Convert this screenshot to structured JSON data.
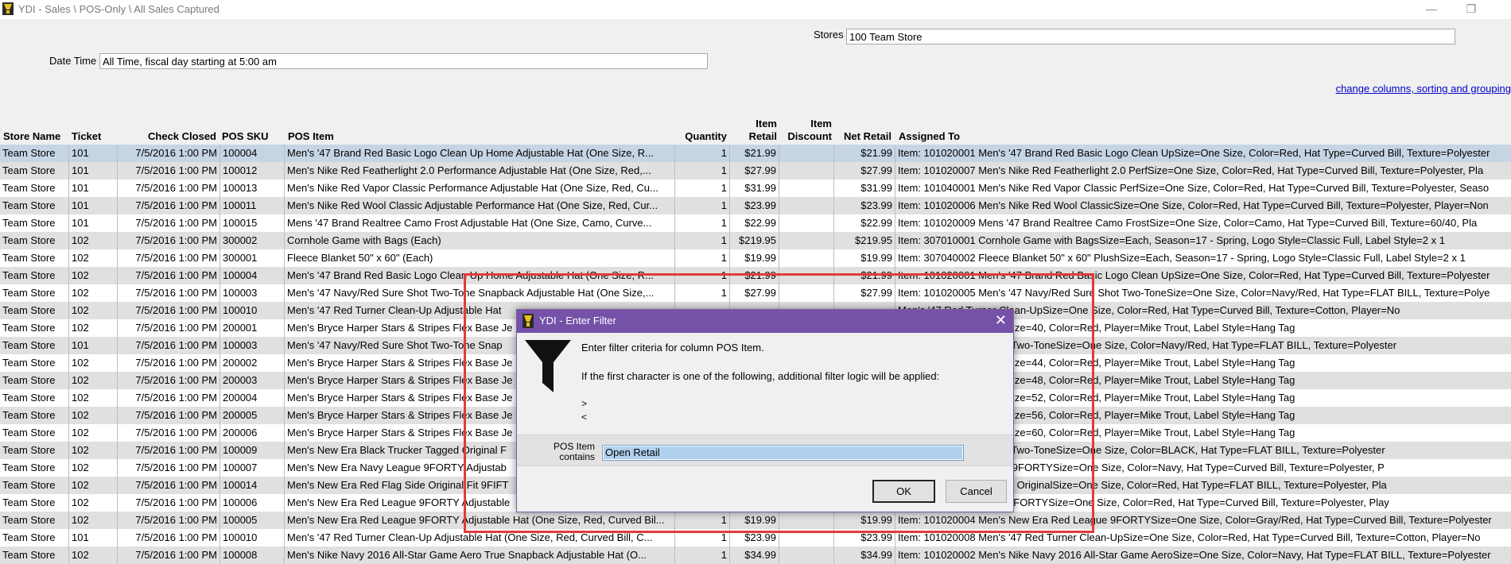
{
  "window": {
    "title": "YDI - Sales \\ POS-Only \\ All Sales Captured",
    "minimize": "—",
    "maximize": "❐"
  },
  "filters": {
    "stores_label": "Stores",
    "stores_value": "100 Team Store",
    "datetime_label": "Date Time",
    "datetime_value": "All Time, fiscal day starting at 5:00 am",
    "change_link": "change columns, sorting and grouping"
  },
  "columns": {
    "store_name": "Store Name",
    "ticket": "Ticket",
    "check_closed": "Check Closed",
    "pos_sku": "POS SKU",
    "pos_item": "POS Item",
    "quantity": "Quantity",
    "item_retail_1": "Item",
    "item_retail_2": "Retail",
    "item_discount_1": "Item",
    "item_discount_2": "Discount",
    "net_retail": "Net Retail",
    "assigned_to": "Assigned To"
  },
  "rows": [
    {
      "store": "Team Store",
      "ticket": "101",
      "closed": "7/5/2016 1:00 PM",
      "sku": "100004",
      "item": "Men's '47 Brand Red Basic Logo Clean Up Home Adjustable Hat (One Size, R...",
      "qty": "1",
      "retail": "$21.99",
      "discount": "",
      "net": "$21.99",
      "assigned": "Item: 101020001 Men's '47 Brand Red Basic Logo Clean UpSize=One Size, Color=Red, Hat Type=Curved Bill, Texture=Polyester"
    },
    {
      "store": "Team Store",
      "ticket": "101",
      "closed": "7/5/2016 1:00 PM",
      "sku": "100012",
      "item": "Men's Nike Red Featherlight 2.0 Performance Adjustable Hat (One Size, Red,...",
      "qty": "1",
      "retail": "$27.99",
      "discount": "",
      "net": "$27.99",
      "assigned": "Item: 101020007 Men's Nike Red Featherlight 2.0 PerfSize=One Size, Color=Red, Hat Type=Curved Bill, Texture=Polyester, Pla"
    },
    {
      "store": "Team Store",
      "ticket": "101",
      "closed": "7/5/2016 1:00 PM",
      "sku": "100013",
      "item": "Men's Nike Red Vapor Classic Performance Adjustable Hat (One Size, Red, Cu...",
      "qty": "1",
      "retail": "$31.99",
      "discount": "",
      "net": "$31.99",
      "assigned": "Item: 101040001 Men's Nike Red Vapor Classic PerfSize=One Size, Color=Red, Hat Type=Curved Bill, Texture=Polyester, Seaso"
    },
    {
      "store": "Team Store",
      "ticket": "101",
      "closed": "7/5/2016 1:00 PM",
      "sku": "100011",
      "item": "Men's Nike Red Wool Classic Adjustable Performance Hat (One Size, Red, Cur...",
      "qty": "1",
      "retail": "$23.99",
      "discount": "",
      "net": "$23.99",
      "assigned": "Item: 101020006 Men's Nike Red Wool ClassicSize=One Size, Color=Red, Hat Type=Curved Bill, Texture=Polyester, Player=Non"
    },
    {
      "store": "Team Store",
      "ticket": "101",
      "closed": "7/5/2016 1:00 PM",
      "sku": "100015",
      "item": "Mens '47 Brand Realtree Camo Frost Adjustable Hat (One Size, Camo, Curve...",
      "qty": "1",
      "retail": "$22.99",
      "discount": "",
      "net": "$22.99",
      "assigned": "Item: 101020009 Mens '47 Brand Realtree Camo FrostSize=One Size, Color=Camo, Hat Type=Curved Bill, Texture=60/40, Pla"
    },
    {
      "store": "Team Store",
      "ticket": "102",
      "closed": "7/5/2016 1:00 PM",
      "sku": "300002",
      "item": "Cornhole Game with Bags (Each)",
      "qty": "1",
      "retail": "$219.95",
      "discount": "",
      "net": "$219.95",
      "assigned": "Item: 307010001 Cornhole Game with BagsSize=Each, Season=17 - Spring, Logo Style=Classic Full, Label Style=2 x 1"
    },
    {
      "store": "Team Store",
      "ticket": "102",
      "closed": "7/5/2016 1:00 PM",
      "sku": "300001",
      "item": "Fleece Blanket 50\" x 60\" (Each)",
      "qty": "1",
      "retail": "$19.99",
      "discount": "",
      "net": "$19.99",
      "assigned": "Item: 307040002 Fleece Blanket 50\" x 60\" PlushSize=Each, Season=17 - Spring, Logo Style=Classic Full, Label Style=2 x 1"
    },
    {
      "store": "Team Store",
      "ticket": "102",
      "closed": "7/5/2016 1:00 PM",
      "sku": "100004",
      "item": "Men's '47 Brand Red Basic Logo Clean Up Home Adjustable Hat (One Size, R...",
      "qty": "1",
      "retail": "$21.99",
      "discount": "",
      "net": "$21.99",
      "assigned": "Item: 101020001 Men's '47 Brand Red Basic Logo Clean UpSize=One Size, Color=Red, Hat Type=Curved Bill, Texture=Polyester"
    },
    {
      "store": "Team Store",
      "ticket": "102",
      "closed": "7/5/2016 1:00 PM",
      "sku": "100003",
      "item": "Men's '47 Navy/Red Sure Shot Two-Tone Snapback Adjustable Hat (One Size,...",
      "qty": "1",
      "retail": "$27.99",
      "discount": "",
      "net": "$27.99",
      "assigned": "Item: 101020005 Men's '47 Navy/Red Sure Shot Two-ToneSize=One Size, Color=Navy/Red, Hat Type=FLAT BILL, Texture=Polye"
    },
    {
      "store": "Team Store",
      "ticket": "102",
      "closed": "7/5/2016 1:00 PM",
      "sku": "100010",
      "item": "Men's '47 Red Turner Clean-Up Adjustable Hat",
      "qty": "",
      "retail": "",
      "discount": "",
      "net": "",
      "assigned": "Men's '47 Red Turner Clean-UpSize=One Size, Color=Red, Hat Type=Curved Bill, Texture=Cotton, Player=No"
    },
    {
      "store": "Team Store",
      "ticket": "102",
      "closed": "7/5/2016 1:00 PM",
      "sku": "200001",
      "item": "Men's Bryce Harper Stars & Stripes Flex Base Je",
      "qty": "",
      "retail": "",
      "discount": "",
      "net": "",
      "assigned": "Trout Cool Base JerseySize=40, Color=Red, Player=Mike Trout, Label Style=Hang Tag"
    },
    {
      "store": "Team Store",
      "ticket": "101",
      "closed": "7/5/2016 1:00 PM",
      "sku": "100003",
      "item": "Men's '47 Navy/Red Sure Shot Two-Tone Snap",
      "qty": "",
      "retail": "",
      "discount": "",
      "net": "",
      "assigned": "'47 Navy/Red Sure Shot Two-ToneSize=One Size, Color=Navy/Red, Hat Type=FLAT BILL, Texture=Polyester"
    },
    {
      "store": "Team Store",
      "ticket": "102",
      "closed": "7/5/2016 1:00 PM",
      "sku": "200002",
      "item": "Men's Bryce Harper Stars & Stripes Flex Base Je",
      "qty": "",
      "retail": "",
      "discount": "",
      "net": "",
      "assigned": "Trout Cool Base JerseySize=44, Color=Red, Player=Mike Trout, Label Style=Hang Tag"
    },
    {
      "store": "Team Store",
      "ticket": "102",
      "closed": "7/5/2016 1:00 PM",
      "sku": "200003",
      "item": "Men's Bryce Harper Stars & Stripes Flex Base Je",
      "qty": "",
      "retail": "",
      "discount": "",
      "net": "",
      "assigned": "Trout Cool Base JerseySize=48, Color=Red, Player=Mike Trout, Label Style=Hang Tag"
    },
    {
      "store": "Team Store",
      "ticket": "102",
      "closed": "7/5/2016 1:00 PM",
      "sku": "200004",
      "item": "Men's Bryce Harper Stars & Stripes Flex Base Je",
      "qty": "",
      "retail": "",
      "discount": "",
      "net": "",
      "assigned": "Trout Cool Base JerseySize=52, Color=Red, Player=Mike Trout, Label Style=Hang Tag"
    },
    {
      "store": "Team Store",
      "ticket": "102",
      "closed": "7/5/2016 1:00 PM",
      "sku": "200005",
      "item": "Men's Bryce Harper Stars & Stripes Flex Base Je",
      "qty": "",
      "retail": "",
      "discount": "",
      "net": "",
      "assigned": "Trout Cool Base JerseySize=56, Color=Red, Player=Mike Trout, Label Style=Hang Tag"
    },
    {
      "store": "Team Store",
      "ticket": "102",
      "closed": "7/5/2016 1:00 PM",
      "sku": "200006",
      "item": "Men's Bryce Harper Stars & Stripes Flex Base Je",
      "qty": "",
      "retail": "",
      "discount": "",
      "net": "",
      "assigned": "Trout Cool Base JerseySize=60, Color=Red, Player=Mike Trout, Label Style=Hang Tag"
    },
    {
      "store": "Team Store",
      "ticket": "102",
      "closed": "7/5/2016 1:00 PM",
      "sku": "100009",
      "item": "Men's New Era Black Trucker Tagged Original F",
      "qty": "",
      "retail": "",
      "discount": "",
      "net": "",
      "assigned": "'47 Navy/Red Sure Shot Two-ToneSize=One Size, Color=BLACK, Hat Type=FLAT BILL, Texture=Polyester"
    },
    {
      "store": "Team Store",
      "ticket": "102",
      "closed": "7/5/2016 1:00 PM",
      "sku": "100007",
      "item": "Men's New Era Navy League 9FORTY Adjustab",
      "qty": "",
      "retail": "",
      "discount": "",
      "net": "",
      "assigned": "s New Era Navy League 9FORTYSize=One Size, Color=Navy, Hat Type=Curved Bill, Texture=Polyester, P"
    },
    {
      "store": "Team Store",
      "ticket": "102",
      "closed": "7/5/2016 1:00 PM",
      "sku": "100014",
      "item": "Men's New Era Red Flag Side Original Fit 9FIFT",
      "qty": "",
      "retail": "",
      "discount": "",
      "net": "",
      "assigned": "s New Era Red Flag Side OriginalSize=One Size, Color=Red, Hat Type=FLAT BILL, Texture=Polyester, Pla"
    },
    {
      "store": "Team Store",
      "ticket": "102",
      "closed": "7/5/2016 1:00 PM",
      "sku": "100006",
      "item": "Men's New Era Red League 9FORTY Adjustable",
      "qty": "",
      "retail": "",
      "discount": "",
      "net": "",
      "assigned": "s New Era Red League 9FORTYSize=One Size, Color=Red, Hat Type=Curved Bill, Texture=Polyester, Play"
    },
    {
      "store": "Team Store",
      "ticket": "102",
      "closed": "7/5/2016 1:00 PM",
      "sku": "100005",
      "item": "Men's New Era Red League 9FORTY Adjustable Hat (One Size, Red, Curved Bil...",
      "qty": "1",
      "retail": "$19.99",
      "discount": "",
      "net": "$19.99",
      "assigned": "Item: 101020004 Men's New Era Red League 9FORTYSize=One Size, Color=Gray/Red, Hat Type=Curved Bill, Texture=Polyester"
    },
    {
      "store": "Team Store",
      "ticket": "101",
      "closed": "7/5/2016 1:00 PM",
      "sku": "100010",
      "item": "Men's '47 Red Turner Clean-Up Adjustable Hat (One Size, Red, Curved Bill, C...",
      "qty": "1",
      "retail": "$23.99",
      "discount": "",
      "net": "$23.99",
      "assigned": "Item: 101020008 Men's '47 Red Turner Clean-UpSize=One Size, Color=Red, Hat Type=Curved Bill, Texture=Cotton, Player=No"
    },
    {
      "store": "Team Store",
      "ticket": "102",
      "closed": "7/5/2016 1:00 PM",
      "sku": "100008",
      "item": "Men's Nike Navy 2016 All-Star Game Aero True Snapback Adjustable Hat (O...",
      "qty": "1",
      "retail": "$34.99",
      "discount": "",
      "net": "$34.99",
      "assigned": "Item: 101020002 Men's Nike Navy 2016 All-Star Game AeroSize=One Size, Color=Navy, Hat Type=FLAT BILL, Texture=Polyester"
    }
  ],
  "dialog": {
    "title": "YDI - Enter Filter",
    "close": "✕",
    "line1": "Enter filter criteria for column POS Item.",
    "line2": "If the first character is one of the following, additional filter logic will be applied:",
    "op_gt": ">",
    "op_lt": "<",
    "field_label_1": "POS Item",
    "field_label_2": "contains",
    "field_value": "Open Retail",
    "ok": "OK",
    "cancel": "Cancel"
  },
  "colors": {
    "dialog_title": "#7551a8",
    "selected_row": "#c6d5e4",
    "highlight_border": "#e23b3b"
  }
}
